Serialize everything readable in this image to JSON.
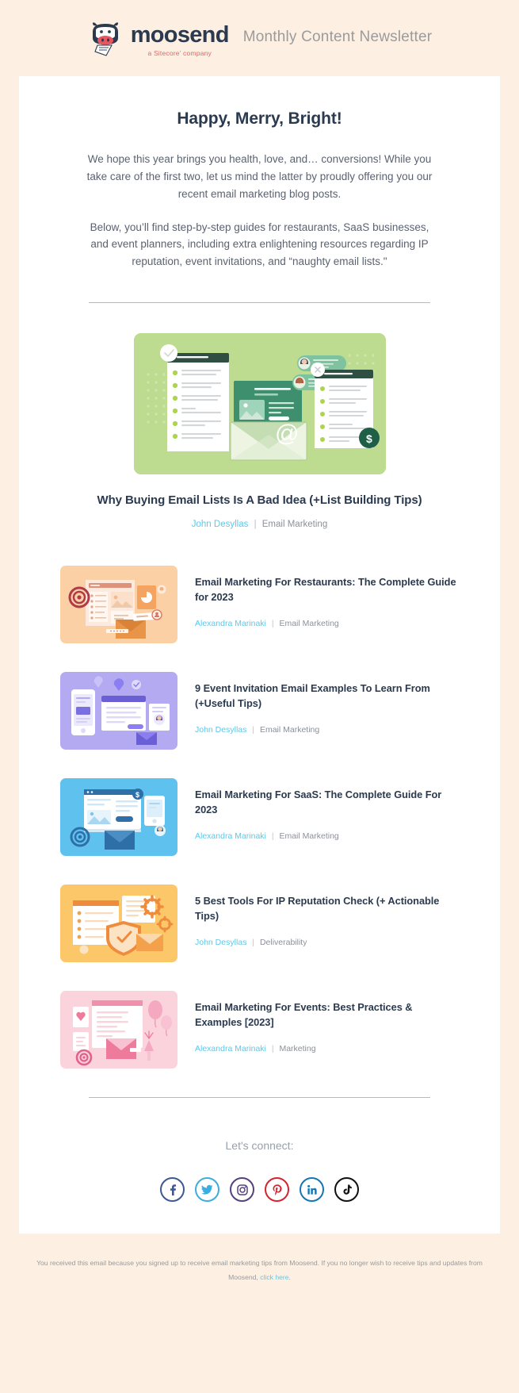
{
  "header": {
    "brand_name": "moosend",
    "brand_tagline": "a Sitecore’ company",
    "title": "Monthly Content Newsletter"
  },
  "intro": {
    "headline": "Happy, Merry, Bright!",
    "paragraph_1": "We hope this year brings you health, love, and… conversions! While you take care of the first two, let us mind the latter by proudly offering you our recent email marketing blog posts.",
    "paragraph_2": "Below, you’ll find step-by-step guides for restaurants, SaaS businesses, and event planners, including extra enlightening resources regarding IP reputation, event invitations, and “naughty email lists.\""
  },
  "hero": {
    "title": "Why Buying Email Lists Is A Bad Idea (+List Building Tips)",
    "author": "John Desyllas",
    "separator": "|",
    "category": "Email Marketing",
    "image_bg": "#bddc8f"
  },
  "articles": [
    {
      "title": "Email Marketing For Restaurants: The Complete Guide for 2023",
      "author": "Alexandra Marinaki",
      "separator": "|",
      "category": "Email Marketing",
      "thumb_bg": "#fbd0a4",
      "thumb_kind": "restaurants"
    },
    {
      "title": "9 Event Invitation Email Examples To Learn From (+Useful Tips)",
      "author": "John Desyllas",
      "separator": "|",
      "category": "Email Marketing",
      "thumb_bg": "#b3aaf2",
      "thumb_kind": "events"
    },
    {
      "title": "Email Marketing For SaaS: The Complete Guide For 2023",
      "author": "Alexandra Marinaki",
      "separator": "|",
      "category": "Email Marketing",
      "thumb_bg": "#5ec1ee",
      "thumb_kind": "saas"
    },
    {
      "title": "5 Best Tools For IP Reputation Check (+ Actionable Tips)",
      "author": "John Desyllas",
      "separator": "|",
      "category": "Deliverability",
      "thumb_bg": "#fcc769",
      "thumb_kind": "reputation"
    },
    {
      "title": "Email Marketing For Events: Best Practices & Examples [2023]",
      "author": "Alexandra Marinaki",
      "separator": "|",
      "category": "Marketing",
      "thumb_bg": "#fbd3dd",
      "thumb_kind": "events-pink"
    }
  ],
  "footer": {
    "connect_label": "Let's connect:",
    "socials": [
      {
        "name": "facebook",
        "color": "#3b5998"
      },
      {
        "name": "twitter",
        "color": "#3aaee0"
      },
      {
        "name": "instagram",
        "color": "#54427f"
      },
      {
        "name": "pinterest",
        "color": "#d8232f"
      },
      {
        "name": "linkedin",
        "color": "#1277b5"
      },
      {
        "name": "tiktok",
        "color": "#111111"
      }
    ],
    "disclaimer_text": "You received this email because you signed up to receive email marketing tips from Moosend. If you no longer wish to receive tips and updates from Moosend,",
    "disclaimer_link": "click here",
    "disclaimer_end": "."
  },
  "colors": {
    "page_bg": "#fdf0e3",
    "card_bg": "#ffffff",
    "heading": "#2b3a4f",
    "body_text": "#5b6270",
    "link": "#5ec8e8",
    "muted": "#8b9099"
  }
}
